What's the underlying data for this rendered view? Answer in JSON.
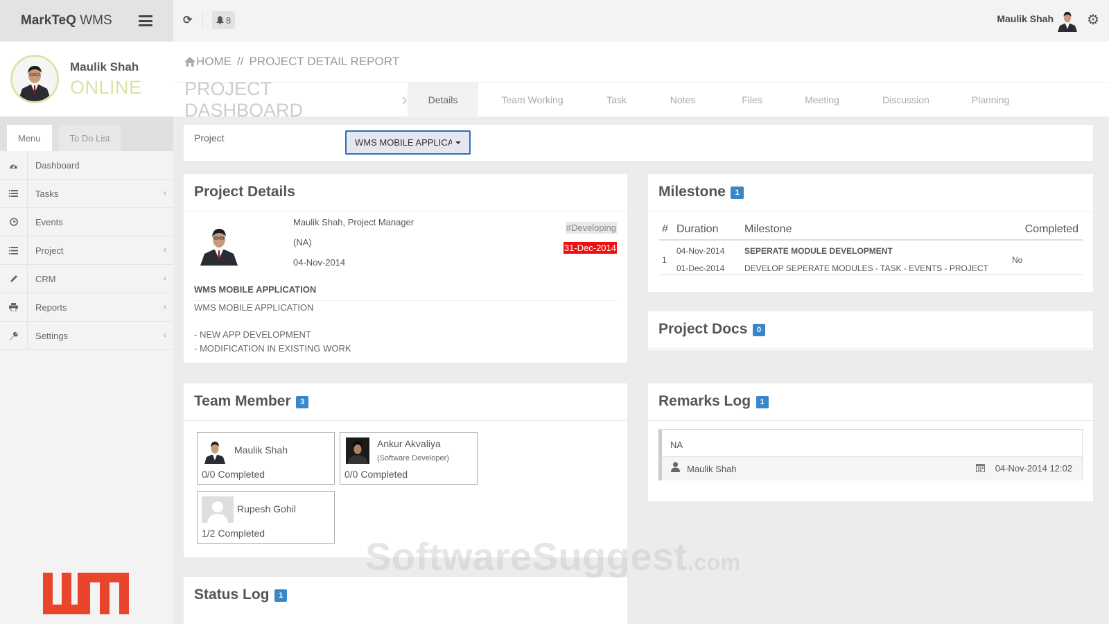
{
  "brand": {
    "name_bold": "MarkTeQ",
    "name_light": "WMS"
  },
  "profile": {
    "name": "Maulik Shah",
    "status": "ONLINE"
  },
  "side_tabs": [
    {
      "label": "Menu"
    },
    {
      "label": "To Do List"
    }
  ],
  "menu": [
    {
      "label": "Dashboard",
      "icon": "dashboard-icon"
    },
    {
      "label": "Tasks",
      "icon": "tasks-icon"
    },
    {
      "label": "Events",
      "icon": "events-icon"
    },
    {
      "label": "Project",
      "icon": "project-icon"
    },
    {
      "label": "CRM",
      "icon": "pencil-icon"
    },
    {
      "label": "Reports",
      "icon": "printer-icon"
    },
    {
      "label": "Settings",
      "icon": "wrench-icon"
    }
  ],
  "topbar": {
    "notifications": "8",
    "user": "Maulik Shah"
  },
  "breadcrumb": {
    "home": "HOME",
    "separator": "//",
    "current": "PROJECT DETAIL REPORT"
  },
  "dashboard_title": "PROJECT DASHBOARD",
  "nav_tabs": [
    {
      "label": "Details"
    },
    {
      "label": "Team Working"
    },
    {
      "label": "Task"
    },
    {
      "label": "Notes"
    },
    {
      "label": "Files"
    },
    {
      "label": "Meeting"
    },
    {
      "label": "Discussion"
    },
    {
      "label": "Planning"
    }
  ],
  "project_filter": {
    "label": "Project",
    "selected": "WMS MOBILE APPLICATION"
  },
  "project_details": {
    "title": "Project Details",
    "manager": "Maulik Shah, Project Manager",
    "client": "(NA)",
    "start_date": "04-Nov-2014",
    "status": "#Developing",
    "deadline": "31-Dec-2014",
    "name": "WMS MOBILE APPLICATION",
    "description": [
      "WMS MOBILE APPLICATION",
      "- NEW APP DEVELOPMENT",
      "- MODIFICATION IN EXISTING WORK"
    ]
  },
  "milestone": {
    "title": "Milestone",
    "count": "1",
    "headers": {
      "num": "#",
      "duration": "Duration",
      "milestone": "Milestone",
      "completed": "Completed"
    },
    "rows": [
      {
        "num": "1",
        "start": "04-Nov-2014",
        "end": "01-Dec-2014",
        "name": "SEPERATE MODULE DEVELOPMENT",
        "desc": "DEVELOP SEPERATE MODULES - TASK - EVENTS - PROJECT",
        "completed": "No"
      }
    ]
  },
  "project_docs": {
    "title": "Project Docs",
    "count": "0"
  },
  "team": {
    "title": "Team Member",
    "count": "3",
    "members": [
      {
        "name": "Maulik Shah",
        "role": "",
        "progress": "0/0 Completed"
      },
      {
        "name": "Ankur Akvaliya",
        "role": "(Software Developer)",
        "progress": "0/0 Completed"
      },
      {
        "name": "Rupesh Gohil",
        "role": "",
        "progress": "1/2 Completed"
      }
    ]
  },
  "remarks": {
    "title": "Remarks Log",
    "count": "1",
    "text": "NA",
    "user": "Maulik Shah",
    "datetime": "04-Nov-2014 12:02"
  },
  "status_log": {
    "title": "Status Log",
    "count": "1"
  },
  "watermark": {
    "main": "SoftwareSuggest",
    "suffix": ".com"
  },
  "colors": {
    "accent": "#3a87c8",
    "online": "#d7e4a0",
    "deadline": "#ee1111",
    "logo": "#e8452c"
  }
}
